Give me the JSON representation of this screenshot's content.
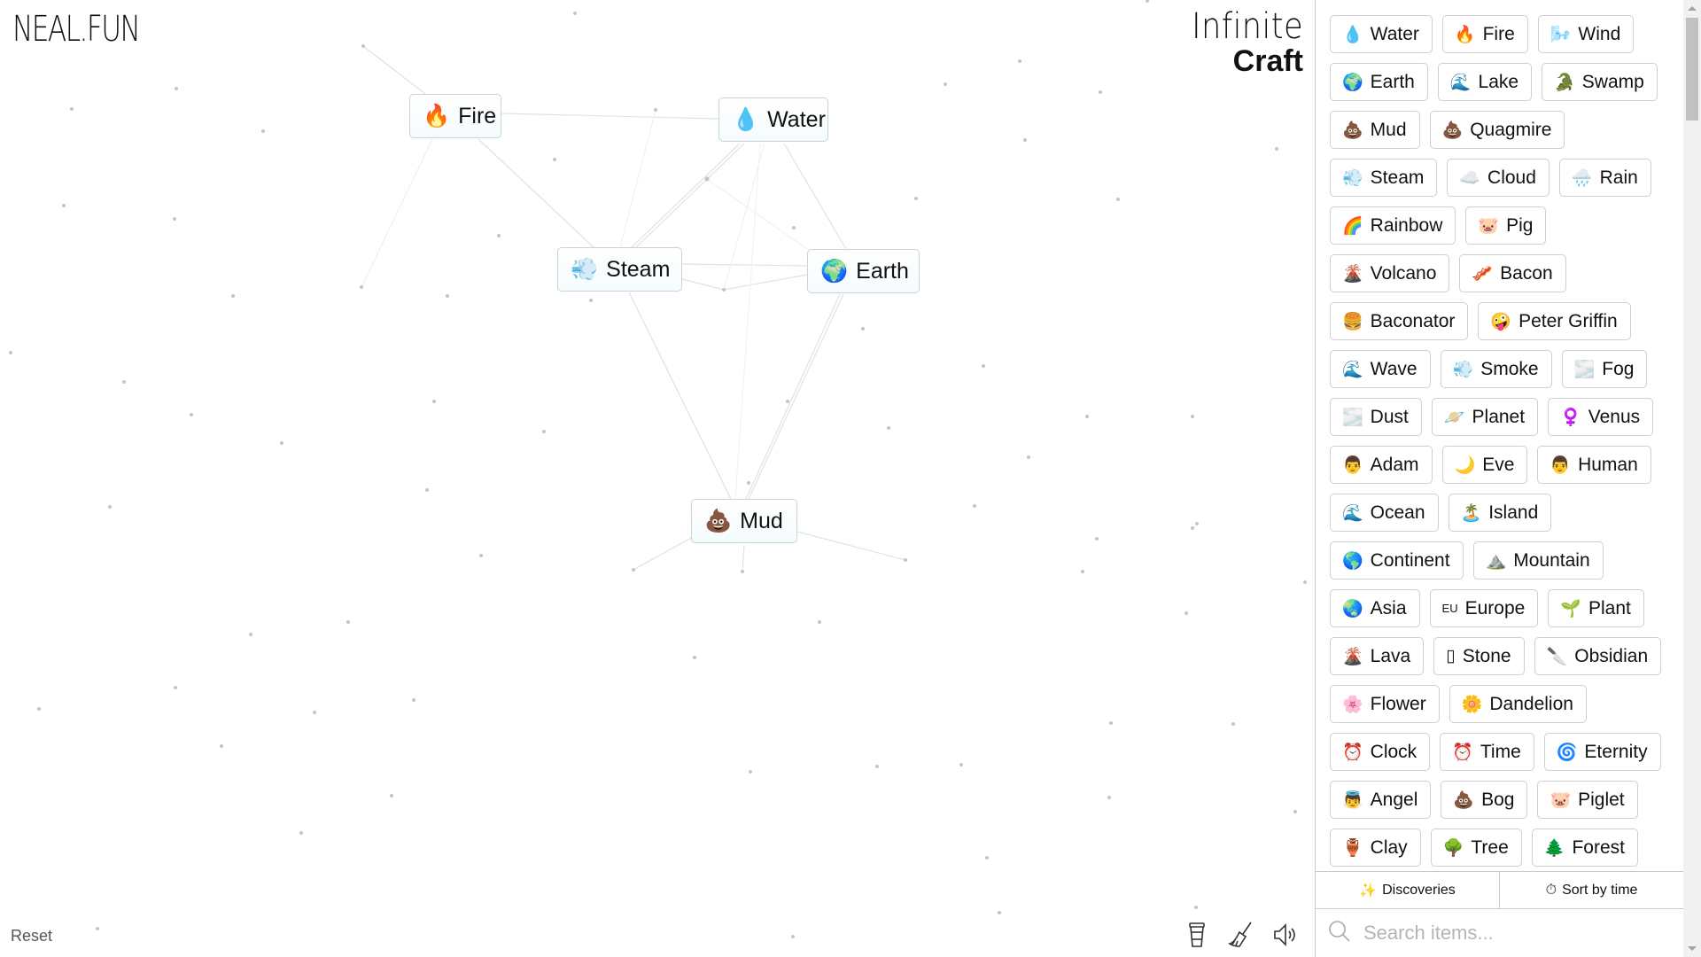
{
  "header": {
    "site_logo": "NEAL.FUN",
    "title_line1": "Infinite",
    "title_line2": "Craft"
  },
  "canvas": {
    "items": [
      {
        "name": "Fire",
        "emoji": "🔥"
      },
      {
        "name": "Water",
        "emoji": "💧"
      },
      {
        "name": "Steam",
        "emoji": "💨"
      },
      {
        "name": "Earth",
        "emoji": "🌍"
      },
      {
        "name": "Mud",
        "emoji": "💩"
      }
    ],
    "reset_label": "Reset",
    "tools": [
      "coffee-icon",
      "broom-icon",
      "sound-icon"
    ]
  },
  "sidebar": {
    "rows": [
      [
        {
          "name": "Water",
          "emoji": "💧"
        },
        {
          "name": "Fire",
          "emoji": "🔥"
        },
        {
          "name": "Wind",
          "emoji": "🌬️"
        }
      ],
      [
        {
          "name": "Earth",
          "emoji": "🌍"
        },
        {
          "name": "Lake",
          "emoji": "🌊"
        },
        {
          "name": "Swamp",
          "emoji": "🐊"
        }
      ],
      [
        {
          "name": "Mud",
          "emoji": "💩"
        },
        {
          "name": "Quagmire",
          "emoji": "💩"
        }
      ],
      [
        {
          "name": "Steam",
          "emoji": "💨"
        },
        {
          "name": "Cloud",
          "emoji": "☁️"
        },
        {
          "name": "Rain",
          "emoji": "🌧️"
        }
      ],
      [
        {
          "name": "Rainbow",
          "emoji": "🌈"
        },
        {
          "name": "Pig",
          "emoji": "🐷"
        }
      ],
      [
        {
          "name": "Volcano",
          "emoji": "🌋"
        },
        {
          "name": "Bacon",
          "emoji": "🥓"
        }
      ],
      [
        {
          "name": "Baconator",
          "emoji": "🍔"
        },
        {
          "name": "Peter Griffin",
          "emoji": "🤪"
        }
      ],
      [
        {
          "name": "Wave",
          "emoji": "🌊"
        },
        {
          "name": "Smoke",
          "emoji": "💨"
        },
        {
          "name": "Fog",
          "emoji": "🌫️"
        }
      ],
      [
        {
          "name": "Dust",
          "emoji": "🌫️"
        },
        {
          "name": "Planet",
          "emoji": "🪐"
        },
        {
          "name": "Venus",
          "emoji": "♀️"
        }
      ],
      [
        {
          "name": "Adam",
          "emoji": "👨"
        },
        {
          "name": "Eve",
          "emoji": "🌙"
        },
        {
          "name": "Human",
          "emoji": "👨"
        }
      ],
      [
        {
          "name": "Ocean",
          "emoji": "🌊"
        },
        {
          "name": "Island",
          "emoji": "🏝️"
        }
      ],
      [
        {
          "name": "Continent",
          "emoji": "🌎"
        },
        {
          "name": "Mountain",
          "emoji": "⛰️"
        }
      ],
      [
        {
          "name": "Asia",
          "emoji": "🌏"
        },
        {
          "name": "Europe",
          "emoji": "EU"
        },
        {
          "name": "Plant",
          "emoji": "🌱"
        }
      ],
      [
        {
          "name": "Lava",
          "emoji": "🌋"
        },
        {
          "name": "Stone",
          "emoji": "▯"
        },
        {
          "name": "Obsidian",
          "emoji": "🔪"
        }
      ],
      [
        {
          "name": "Flower",
          "emoji": "🌸"
        },
        {
          "name": "Dandelion",
          "emoji": "🌼"
        }
      ],
      [
        {
          "name": "Clock",
          "emoji": "⏰"
        },
        {
          "name": "Time",
          "emoji": "⏰"
        },
        {
          "name": "Eternity",
          "emoji": "🌀"
        }
      ],
      [
        {
          "name": "Angel",
          "emoji": "👼"
        },
        {
          "name": "Bog",
          "emoji": "💩"
        },
        {
          "name": "Piglet",
          "emoji": "🐷"
        }
      ],
      [
        {
          "name": "Clay",
          "emoji": "🏺"
        },
        {
          "name": "Tree",
          "emoji": "🌳"
        },
        {
          "name": "Forest",
          "emoji": "🌲"
        }
      ]
    ],
    "discoveries_label": "Discoveries",
    "sort_label": "Sort by time",
    "search_placeholder": "Search items..."
  }
}
